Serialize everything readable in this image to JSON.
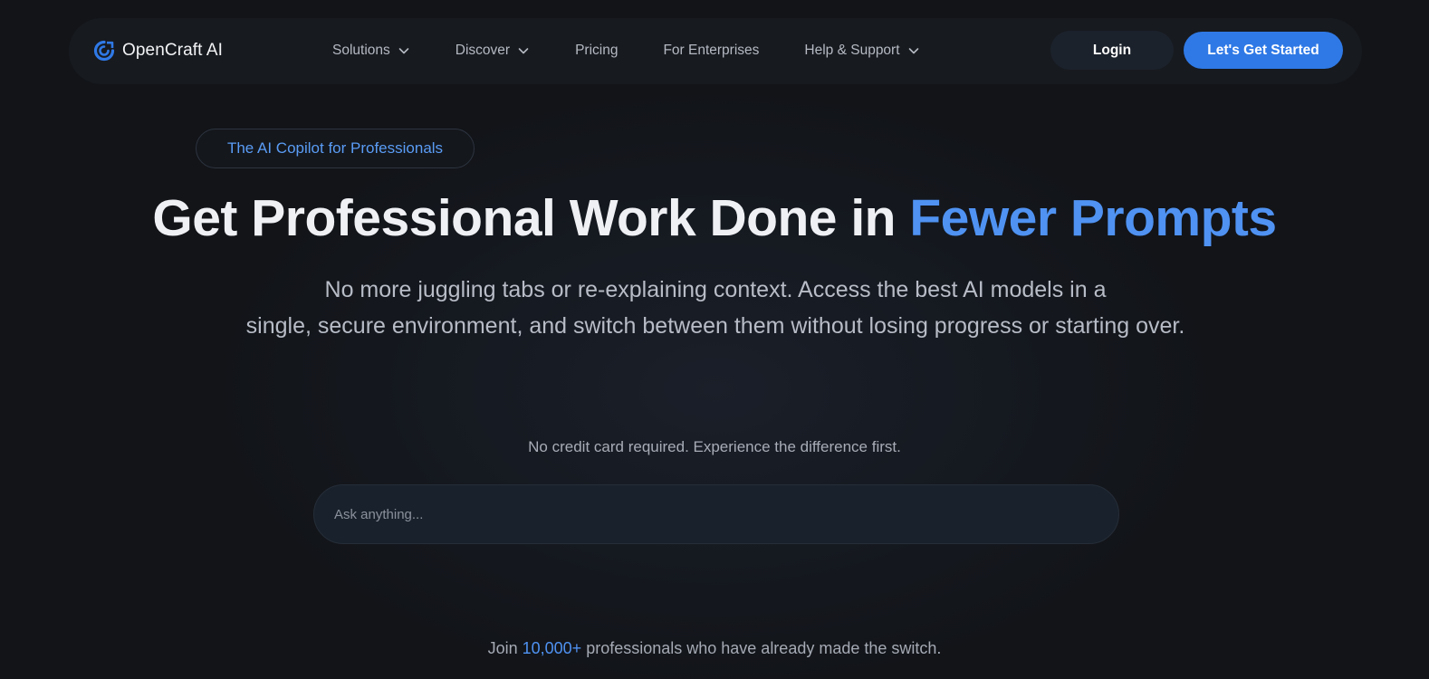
{
  "brand": {
    "name": "OpenCraft AI",
    "logo_icon": "opencraft-logo-icon",
    "logo_color": "#2f79e6"
  },
  "nav": {
    "items": [
      {
        "label": "Solutions",
        "has_dropdown": true
      },
      {
        "label": "Discover",
        "has_dropdown": true
      },
      {
        "label": "Pricing",
        "has_dropdown": false
      },
      {
        "label": "For Enterprises",
        "has_dropdown": false
      },
      {
        "label": "Help & Support",
        "has_dropdown": true
      }
    ],
    "login_label": "Login",
    "cta_label": "Let's Get Started"
  },
  "hero": {
    "badge": "The AI Copilot for Professionals",
    "title_main": "Get Professional Work Done in ",
    "title_accent": "Fewer Prompts",
    "subtitle_line1": "No more juggling tabs or re-explaining context. Access the best AI models in a",
    "subtitle_line2": "single, secure environment, and switch between them without losing progress or starting over.",
    "no_credit_card": "No credit card required. Experience the difference first.",
    "ask_placeholder": "Ask anything...",
    "join_prefix": "Join ",
    "join_count": "10,000+",
    "join_suffix": " professionals who have already made the switch."
  },
  "colors": {
    "accent": "#4f92f2",
    "cta_background": "#2f79e6",
    "page_background": "#121418"
  }
}
